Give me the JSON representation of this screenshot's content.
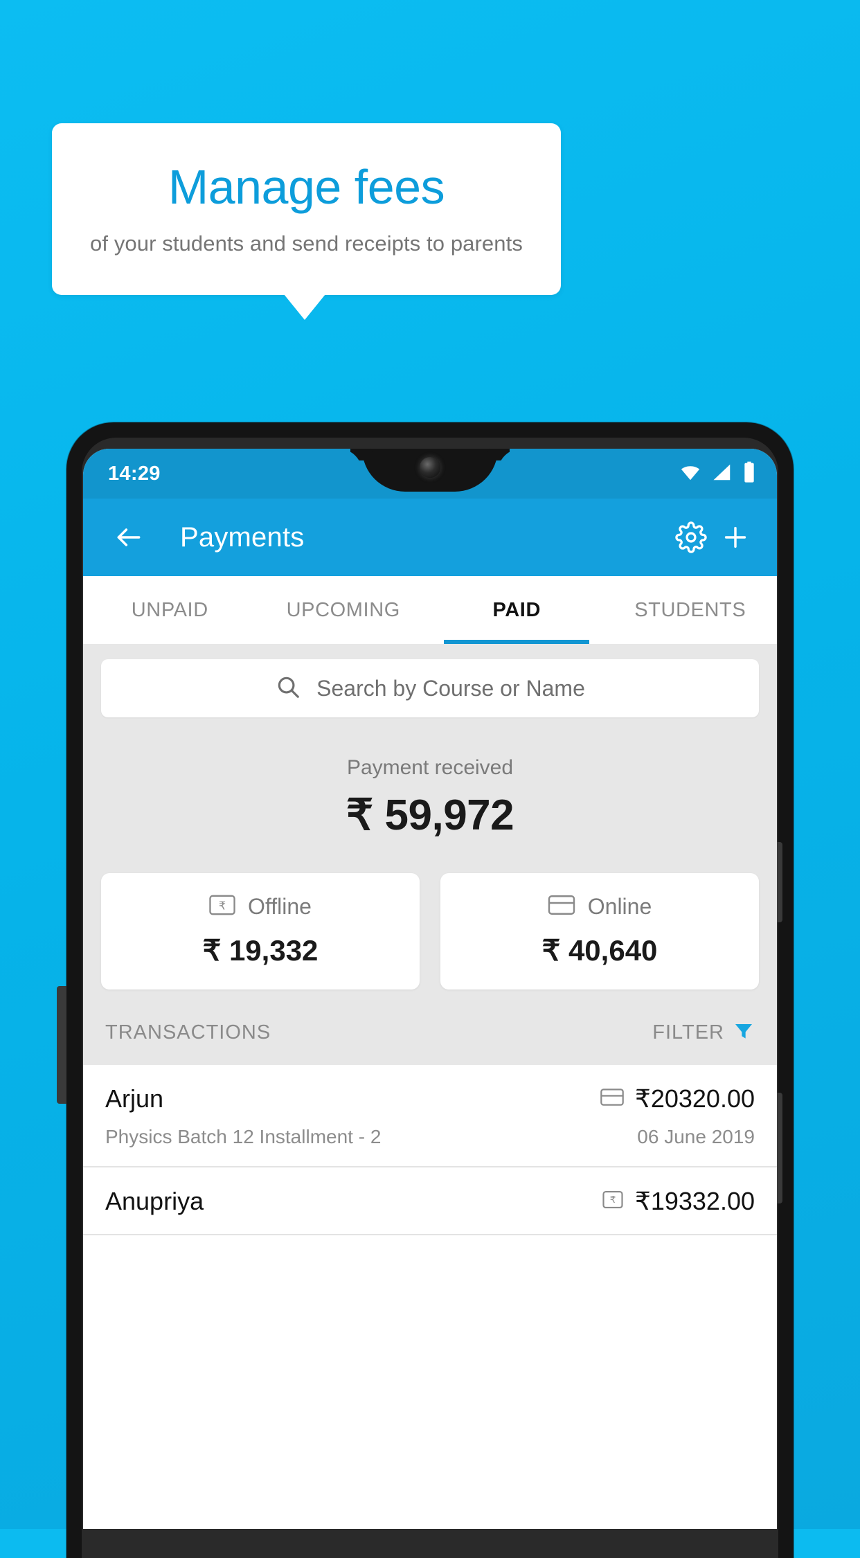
{
  "promo": {
    "title": "Manage fees",
    "subtitle": "of your students and send receipts to parents",
    "title_color": "#0d9ddb",
    "background_color": "#0cbdf2"
  },
  "phone": {
    "status_bar": {
      "time": "14:29",
      "icons": [
        "wifi-icon",
        "signal-icon",
        "battery-icon"
      ],
      "background_color": "#1295cd"
    },
    "app_bar": {
      "back_label": "back-arrow-icon",
      "title": "Payments",
      "settings_label": "gear-icon",
      "add_label": "plus-icon",
      "background_color": "#14a0dd"
    },
    "tabs": [
      {
        "label": "UNPAID",
        "active": false
      },
      {
        "label": "UPCOMING",
        "active": false
      },
      {
        "label": "PAID",
        "active": true
      },
      {
        "label": "STUDENTS",
        "active": false
      }
    ],
    "search": {
      "placeholder": "Search by Course or Name",
      "value": "",
      "icon": "search-icon"
    },
    "summary": {
      "label": "Payment received",
      "amount": "₹ 59,972"
    },
    "methods": [
      {
        "label": "Offline",
        "amount": "₹ 19,332",
        "icon": "cash-note-icon"
      },
      {
        "label": "Online",
        "amount": "₹ 40,640",
        "icon": "credit-card-icon"
      }
    ],
    "list_header": {
      "title": "TRANSACTIONS",
      "filter_label": "FILTER",
      "filter_icon": "funnel-icon",
      "filter_color": "#17a6e0"
    },
    "transactions": [
      {
        "name": "Arjun",
        "amount": "₹20320.00",
        "method_icon": "credit-card-icon",
        "description": "Physics Batch 12 Installment - 2",
        "date": "06 June 2019"
      },
      {
        "name": "Anupriya",
        "amount": "₹19332.00",
        "method_icon": "cash-note-icon",
        "description": "",
        "date": ""
      }
    ]
  }
}
